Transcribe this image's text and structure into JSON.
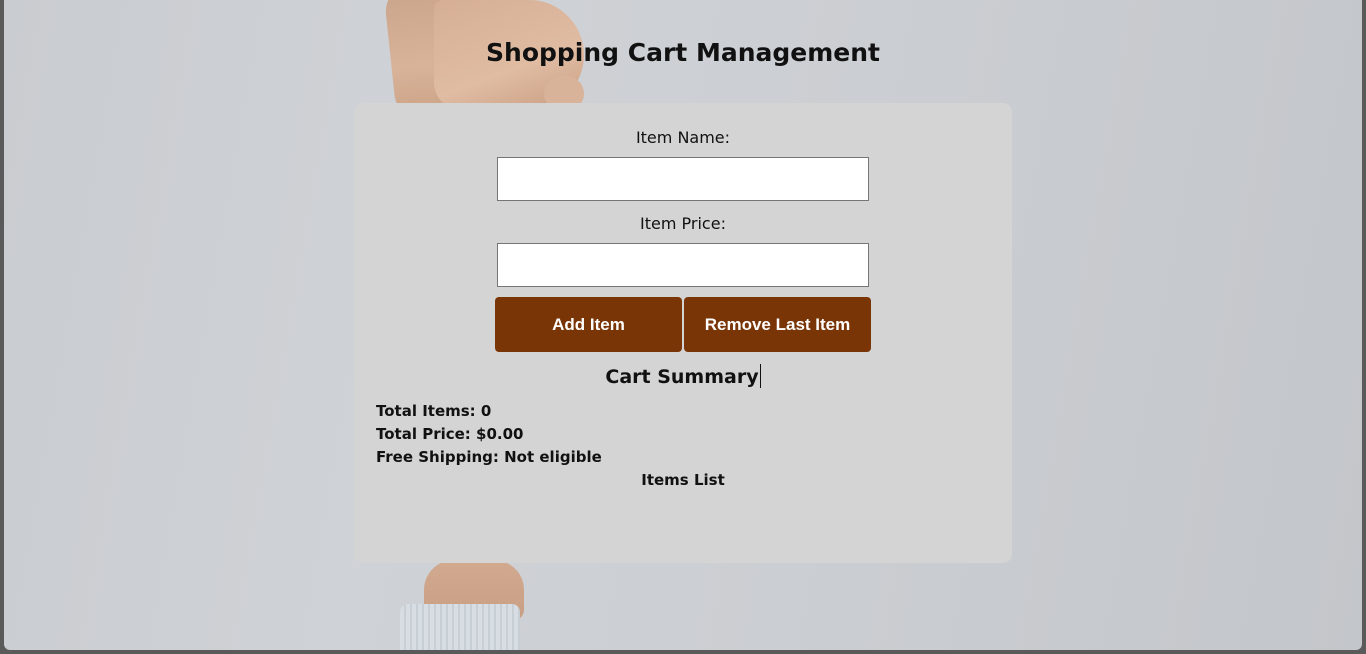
{
  "page": {
    "title": "Shopping Cart Management"
  },
  "form": {
    "item_name_label": "Item Name:",
    "item_name_value": "",
    "item_price_label": "Item Price:",
    "item_price_value": ""
  },
  "buttons": {
    "add_label": "Add Item",
    "remove_label": "Remove Last Item"
  },
  "summary": {
    "title": "Cart Summary",
    "total_items": "Total Items: 0",
    "total_price": "Total Price: $0.00",
    "free_shipping": "Free Shipping: Not eligible"
  },
  "items_list": {
    "title": "Items List",
    "items": []
  },
  "colors": {
    "button_bg": "#7a3507",
    "card_bg": "#d4d4d4",
    "page_bg": "#cfd2d6"
  }
}
